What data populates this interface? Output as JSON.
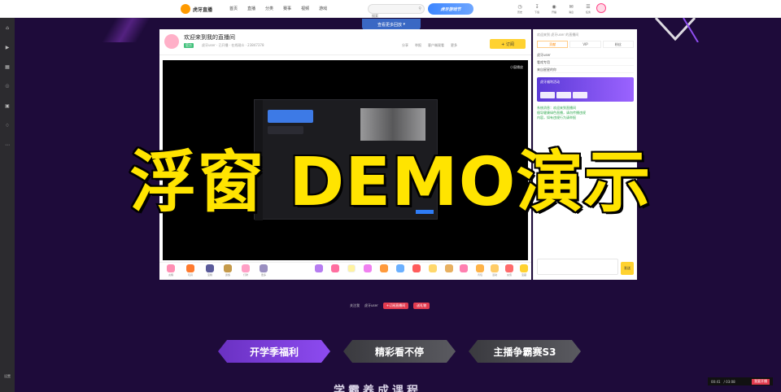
{
  "topnav": {
    "logo_text": "虎牙直播",
    "links": [
      "首页",
      "直播",
      "分类",
      "赛事",
      "视频",
      "游戏"
    ],
    "search_placeholder": "搜索",
    "promo": "虎牙游戏节",
    "icons": [
      {
        "icon": "history-icon",
        "label": "历史"
      },
      {
        "icon": "download-icon",
        "label": "下载"
      },
      {
        "icon": "broadcast-icon",
        "label": "开播"
      },
      {
        "icon": "message-icon",
        "label": "消息"
      },
      {
        "icon": "task-icon",
        "label": "任务"
      }
    ]
  },
  "sidebar": {
    "items": [
      "home-icon",
      "live-icon",
      "category-icon",
      "match-icon",
      "video-icon",
      "game-icon",
      "more-icon"
    ],
    "bottom_label": "设置"
  },
  "top_pill": "查看更多回放",
  "room": {
    "title": "欢迎来到我的直播间",
    "tag": "官方",
    "meta": "虎牙user  ·  已开播  ·  在线观众  ·  23847378",
    "actions": [
      "分享",
      "举报",
      "客户端观看",
      "更多"
    ],
    "follow": "+ 订阅",
    "mini_window": "小窗播放"
  },
  "gifts": [
    "虎粮",
    "玩具",
    "宝箱",
    "贵族",
    "灯牌",
    "更多",
    "",
    "",
    "",
    "",
    "",
    "",
    "",
    "",
    "",
    "",
    "背包",
    "活动",
    "充值",
    "宝藏"
  ],
  "chat": {
    "top": "欢迎来到 虎牙user 的直播间",
    "tabs": [
      "贡献",
      "VIP",
      "粉丝"
    ],
    "rows": [
      "虎牙user",
      "看戏专用",
      "来自星星的你"
    ],
    "banner": "虎牙福利活动",
    "messages": [
      "系统消息：欢迎来到直播间",
      "倡导健康绿色直播，请勿传播违规",
      "内容，如有违规行为请举报"
    ],
    "send": "发送"
  },
  "overlay_title": "浮窗 DEMO演示",
  "mini_row": {
    "text": "关注我",
    "name": "虎牙user",
    "btn1": "+订阅直播间",
    "btn2": "送礼物"
  },
  "promo_tabs": [
    "开学季福利",
    "精彩看不停",
    "主播争霸赛S3"
  ],
  "bottom_cut": "学霸养成课程",
  "corner": {
    "time": "00:41",
    "total": "/ 03:08",
    "cta": "我要开播"
  }
}
